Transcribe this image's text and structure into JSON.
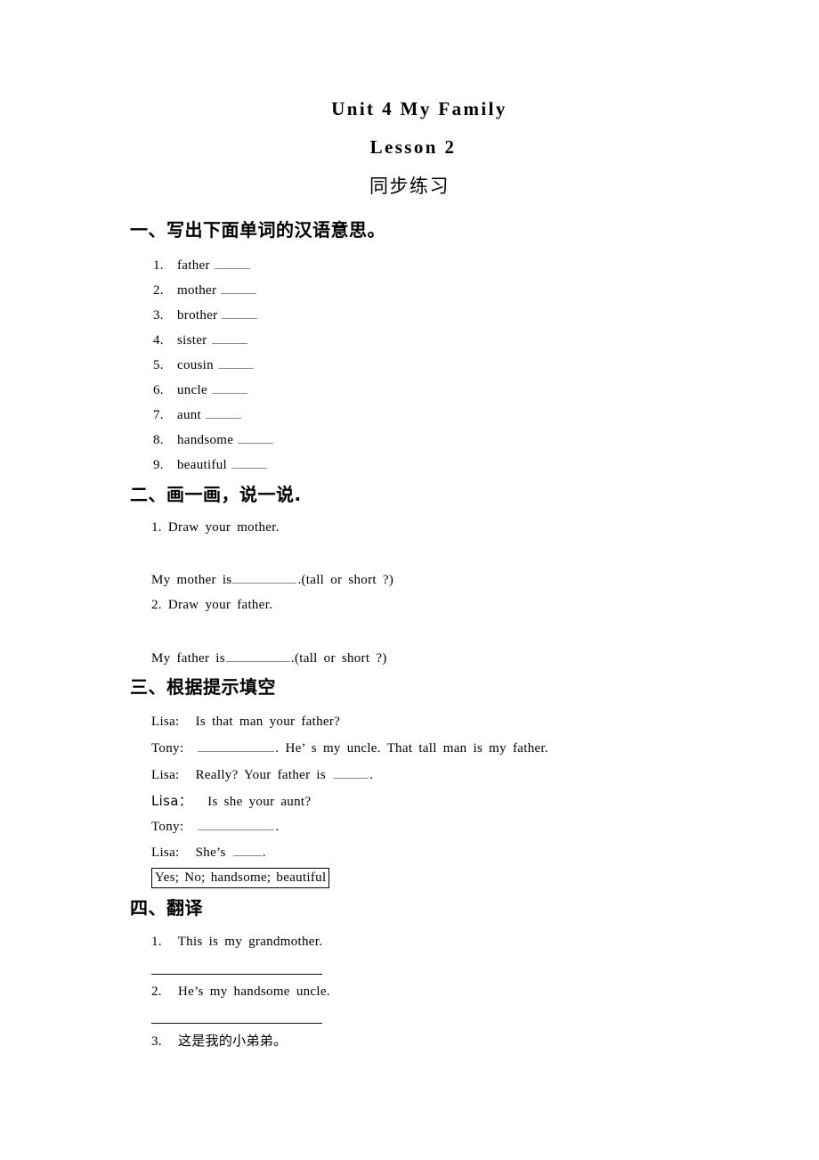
{
  "document": {
    "title": "Unit  4  My  Family",
    "subtitle": "Lesson  2",
    "subtitle_cn": "同步练习"
  },
  "sections": [
    {
      "heading": "一、写出下面单词的汉语意思。",
      "type": "word-list",
      "items": [
        {
          "number": "1.",
          "word": "father"
        },
        {
          "number": "2.",
          "word": "mother"
        },
        {
          "number": "3.",
          "word": "brother"
        },
        {
          "number": "4.",
          "word": "sister"
        },
        {
          "number": "5.",
          "word": "cousin"
        },
        {
          "number": "6.",
          "word": "uncle"
        },
        {
          "number": "7.",
          "word": "aunt"
        },
        {
          "number": "8.",
          "word": "handsome"
        },
        {
          "number": "9.",
          "word": "beautiful"
        }
      ]
    },
    {
      "heading": "二、画一画，说一说.",
      "type": "draw-and-say",
      "items": [
        {
          "prompt": "1.  Draw  your  mother.",
          "sentence_before": "My  mother  is",
          "sentence_after": ".(tall  or  short  ?)"
        },
        {
          "prompt": "2.  Draw  your  father.",
          "sentence_before": "My  father  is",
          "sentence_after": ".(tall  or  short  ?)"
        }
      ]
    },
    {
      "heading": "三、根据提示填空",
      "type": "dialogue",
      "lines": [
        {
          "speaker": "Lisa:",
          "text_before": "Is  that  man  your  father?",
          "blank": "none",
          "text_after": ""
        },
        {
          "speaker": "Tony:",
          "text_before": "",
          "blank": "long",
          "text_after": ".  He’  s  my  uncle.  That  tall  man  is  my  father."
        },
        {
          "speaker": "Lisa:",
          "text_before": "Really?  Your  father  is",
          "blank": "short",
          "text_after": "."
        },
        {
          "speaker": "Lisa：",
          "text_before": "Is  she  your  aunt?",
          "blank": "none",
          "text_after": ""
        },
        {
          "speaker": "Tony:",
          "text_before": "",
          "blank": "long",
          "text_after": "."
        },
        {
          "speaker": "Lisa:",
          "text_before": "She’s",
          "blank": "short",
          "text_after": "."
        }
      ],
      "answer_bank": "Yes;  No;  handsome;  beautiful"
    },
    {
      "heading": "四、翻译",
      "type": "translate",
      "items": [
        {
          "number": "1.",
          "text": "This  is  my  grandmother.",
          "has_rule": true
        },
        {
          "number": "2.",
          "text": "He’s  my  handsome  uncle.",
          "has_rule": true
        },
        {
          "number": "3.",
          "text": "这是我的小弟弟。",
          "has_rule": false
        }
      ]
    }
  ]
}
